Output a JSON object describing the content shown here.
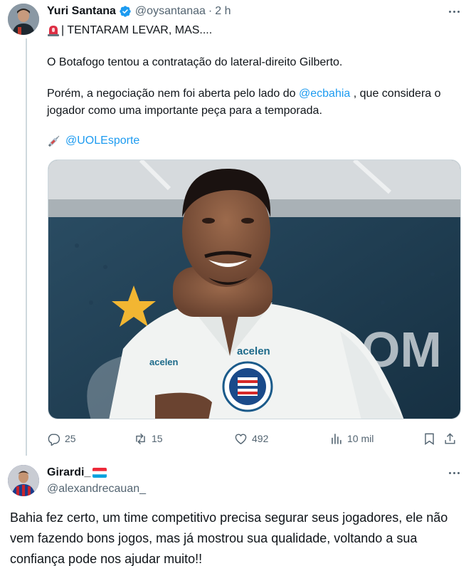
{
  "tweet": {
    "author_name": "Yuri Santana",
    "handle": "@oysantanaa",
    "separator": "·",
    "time": "2 h",
    "headline": "| TENTARAM LEVAR, MAS....",
    "paragraph1": "O Botafogo tentou a contratação do lateral-direito Gilberto.",
    "paragraph2_before": "Porém, a negociação nem foi aberta pelo lado do ",
    "paragraph2_mention": "@ecbahia",
    "paragraph2_after": " , que considera o jogador como uma importante peça para a temporada.",
    "source_mention": "@UOLEsporte",
    "media_icon": "photo-of-player-in-bahia-shirt",
    "stats": {
      "replies": "25",
      "retweets": "15",
      "likes": "492",
      "views": "10 mil"
    }
  },
  "reply": {
    "author_name": "Girardi_",
    "handle": "@alexandrecauan_",
    "text": "Bahia fez certo, um time competitivo precisa segurar seus jogadores, ele não vem fazendo bons jogos, mas já mostrou sua qualidade, voltando a sua confiança pode nos ajudar muito!!"
  },
  "colors": {
    "link": "#1d9bf0",
    "muted": "#536471",
    "text": "#0f1419",
    "divider": "#cfd9de"
  }
}
